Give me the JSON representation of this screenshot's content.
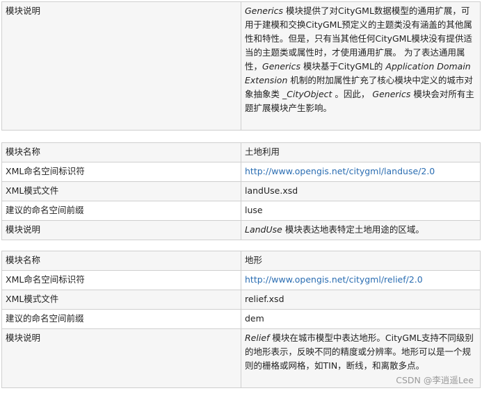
{
  "table1": {
    "desc_label": "模块说明",
    "desc": {
      "p1_em": "Generics",
      "p2": " 模块提供了对CityGML数据模型的通用扩展，可用于建模和交换CityGML预定义的主题类没有涵盖的其他属性和特性。但是，只有当其他任何CityGML模块没有提供适当的主题类或属性时，才使用通用扩展。 为了表达通用属性，",
      "p3_em": "Generics",
      "p4": " 模块基于CityGML的 ",
      "p5_em": "Application Domain Extension",
      "p6": " 机制的附加属性扩充了核心模块中定义的城市对象抽象类 ",
      "p7_em": "_CityObject",
      "p8": " 。因此， ",
      "p9_em": "Generics",
      "p10": " 模块会对所有主题扩展模块产生影响。"
    }
  },
  "table2": {
    "name_label": "模块名称",
    "name_value": "土地利用",
    "ns_label": "XML命名空间标识符",
    "ns_value": "http://www.opengis.net/citygml/landuse/2.0",
    "xsd_label": "XML模式文件",
    "xsd_value": "landUse.xsd",
    "prefix_label": "建议的命名空间前缀",
    "prefix_value": "luse",
    "desc_label": "模块说明",
    "desc_em": "LandUse",
    "desc_rest": " 模块表达地表特定土地用途的区域。"
  },
  "table3": {
    "name_label": "模块名称",
    "name_value": "地形",
    "ns_label": "XML命名空间标识符",
    "ns_value": "http://www.opengis.net/citygml/relief/2.0",
    "xsd_label": "XML模式文件",
    "xsd_value": "relief.xsd",
    "prefix_label": "建议的命名空间前缀",
    "prefix_value": "dem",
    "desc_label": "模块说明",
    "desc_em": "Relief",
    "desc_rest": " 模块在城市模型中表达地形。CityGML支持不同级别的地形表示，反映不同的精度或分辨率。地形可以是一个规则的栅格或网格，如TIN，断线，和离散多点。"
  },
  "watermark": "CSDN @李逍遥Lee",
  "colors": {
    "link": "#2a6db2",
    "border": "#cfcfcf",
    "row_alt": "#f6f6f6"
  }
}
